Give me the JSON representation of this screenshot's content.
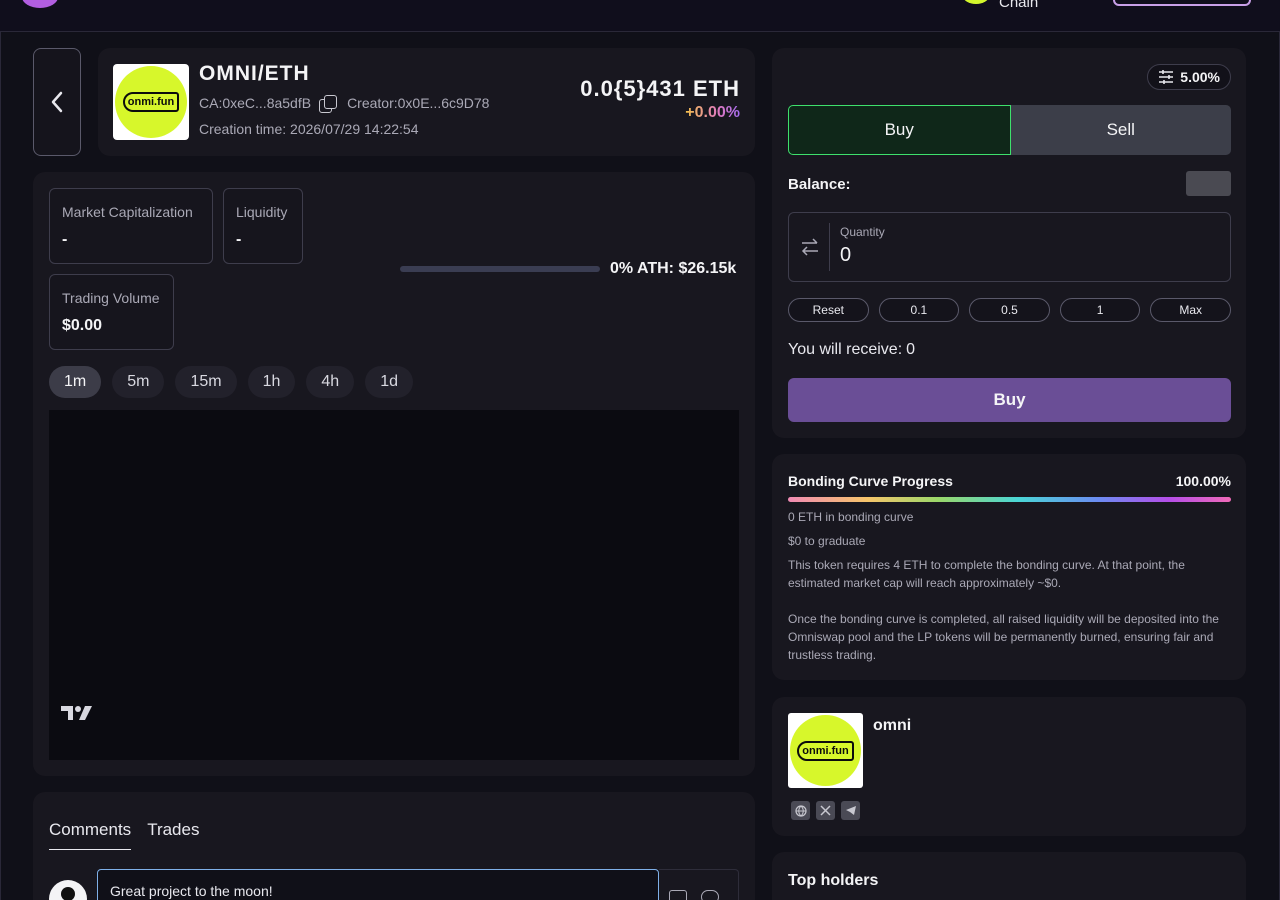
{
  "topbar": {
    "chain_label": "Chain"
  },
  "token": {
    "pair": "OMNI/ETH",
    "logo_text": "onmi.fun",
    "ca": "CA:0xeC...8a5dfB",
    "creator": "Creator:0x0E...6c9D78",
    "created": "Creation time: 2026/07/29 14:22:54",
    "price": "0.0{5}431 ETH",
    "change": "+0.00%"
  },
  "stats": {
    "market_cap_label": "Market Capitalization",
    "market_cap_value": "-",
    "liquidity_label": "Liquidity",
    "liquidity_value": "-",
    "volume_label": "Trading Volume",
    "volume_value": "$0.00",
    "ath_text": "0%  ATH: $26.15k",
    "ath_progress": 0
  },
  "timeframes": [
    "1m",
    "5m",
    "15m",
    "1h",
    "4h",
    "1d"
  ],
  "timeframe_active": "1m",
  "comments": {
    "tab_comments": "Comments",
    "tab_trades": "Trades",
    "input_value": "Great project to the moon!"
  },
  "trade": {
    "slippage": "5.00%",
    "buy_tab": "Buy",
    "sell_tab": "Sell",
    "balance_label": "Balance:",
    "quantity_label": "Quantity",
    "quantity_value": "0",
    "presets": [
      "Reset",
      "0.1",
      "0.5",
      "1",
      "Max"
    ],
    "receive_label": "You will receive:",
    "receive_value": "0",
    "cta": "Buy"
  },
  "bonding": {
    "title": "Bonding Curve Progress",
    "percent_label": "100.00%",
    "percent": 100,
    "line1": "0 ETH in bonding curve",
    "line2": "$0 to graduate",
    "line3": "This token requires 4 ETH to complete the bonding curve. At that point, the estimated market cap will reach approximately ~$0.",
    "line4": "Once the bonding curve is completed, all raised liquidity will be deposited into the Omniswap pool and the LP tokens will be permanently burned, ensuring fair and trustless trading."
  },
  "profile": {
    "name": "omni",
    "logo_text": "onmi.fun",
    "socials": [
      "globe-icon",
      "x-icon",
      "telegram-icon"
    ]
  },
  "holders": {
    "title": "Top holders"
  },
  "colors": {
    "buy_accent": "#3ee06c",
    "cta_purple": "#6a4e96",
    "logo_lime": "#d7f72b"
  }
}
